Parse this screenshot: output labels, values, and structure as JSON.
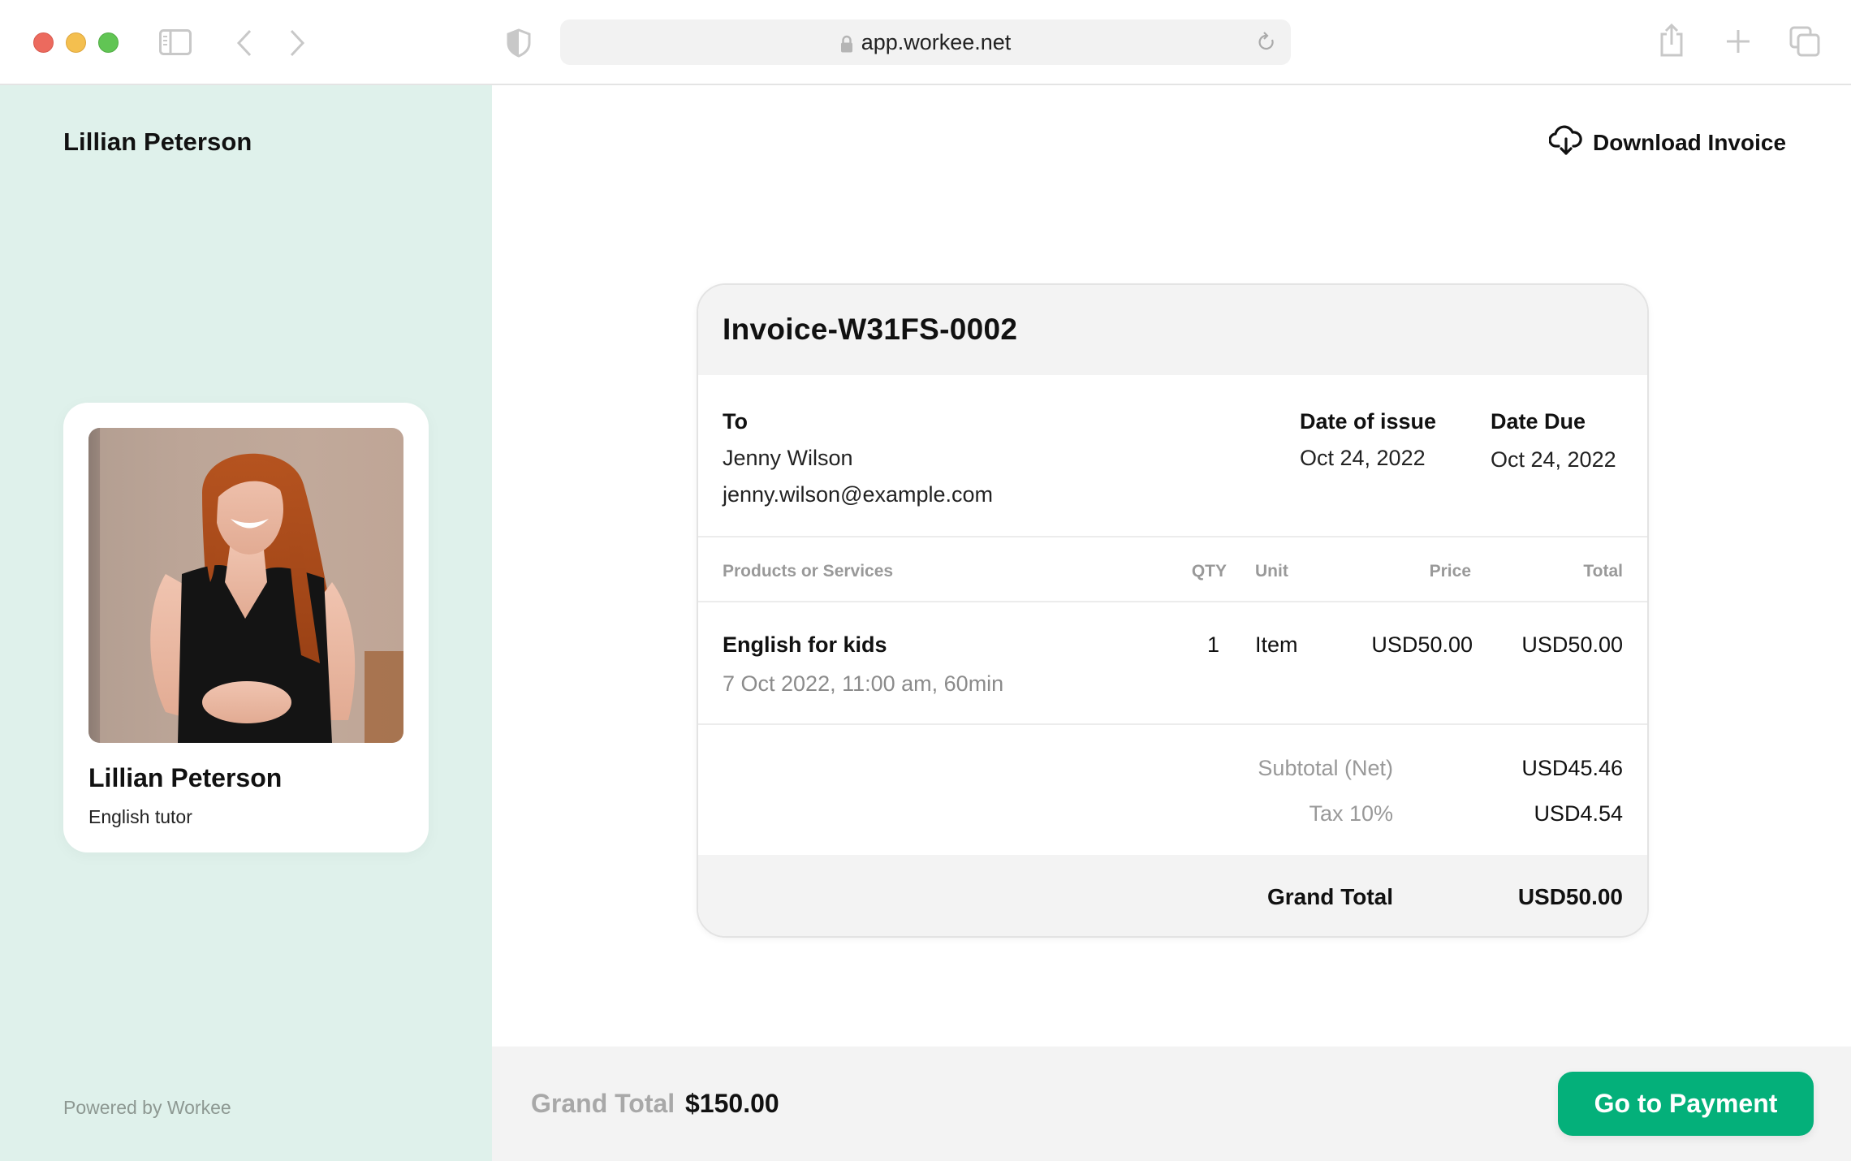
{
  "browser": {
    "url": "app.workee.net",
    "icons": [
      "sidebar-toggle-icon",
      "back-icon",
      "forward-icon",
      "shield-icon",
      "lock-icon",
      "reload-icon",
      "share-icon",
      "new-tab-icon",
      "tabs-overview-icon"
    ]
  },
  "sidebar": {
    "title": "Lillian Peterson",
    "profile": {
      "name": "Lillian Peterson",
      "role": "English tutor"
    },
    "footer": "Powered by Workee"
  },
  "main": {
    "download_label": "Download Invoice",
    "invoice": {
      "number": "Invoice-W31FS-0002",
      "to_label": "To",
      "to_name": "Jenny Wilson",
      "to_email": "jenny.wilson@example.com",
      "issue_label": "Date of issue",
      "issue_date": "Oct 24, 2022",
      "due_label": "Date Due",
      "due_date": "Oct 24, 2022",
      "columns": [
        "Products or Services",
        "QTY",
        "Unit",
        "Price",
        "Total"
      ],
      "items": [
        {
          "name": "English for kids",
          "detail": "7 Oct 2022, 11:00 am, 60min",
          "qty": "1",
          "unit": "Item",
          "price": "USD50.00",
          "total": "USD50.00"
        }
      ],
      "subtotal_label": "Subtotal (Net)",
      "subtotal_value": "USD45.46",
      "tax_label": "Tax 10%",
      "tax_value": "USD4.54",
      "grand_total_label": "Grand Total",
      "grand_total_value": "USD50.00"
    }
  },
  "footer": {
    "grand_total_label": "Grand Total",
    "grand_total_value": "$150.00",
    "pay_button": "Go to Payment"
  },
  "colors": {
    "accent": "#04b07a",
    "sidebar_bg": "#dff1eb",
    "muted_text": "#999999"
  }
}
